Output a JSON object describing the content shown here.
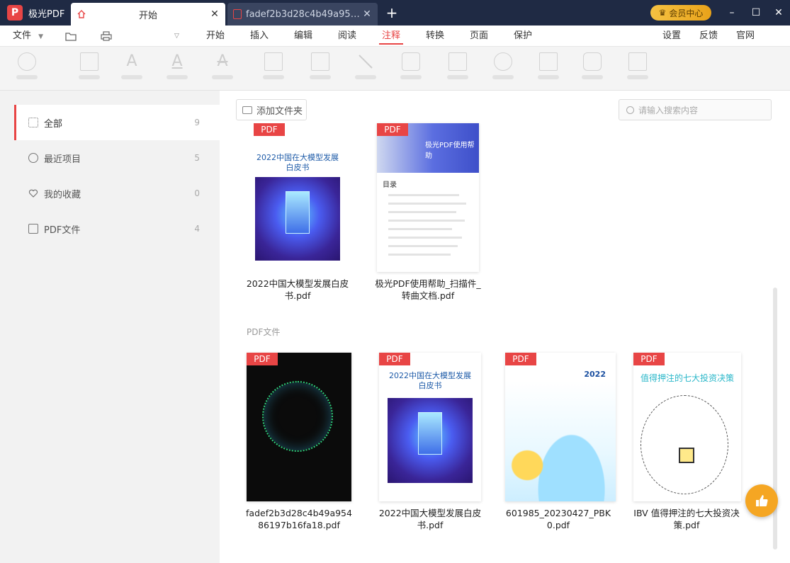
{
  "app": {
    "name": "极光PDF"
  },
  "tabs": [
    {
      "label": "开始",
      "close": "✕"
    },
    {
      "label": "fadef2b3d28c4b49a9548...",
      "close": "✕"
    }
  ],
  "new_tab": "+",
  "vip": {
    "label": "会员中心"
  },
  "window": {
    "minimize": "–",
    "maximize": "☐",
    "close": "✕"
  },
  "menu": {
    "file": "文件",
    "items": [
      "开始",
      "插入",
      "编辑",
      "阅读",
      "注释",
      "转换",
      "页面",
      "保护"
    ],
    "active": "注释",
    "right": [
      "设置",
      "反馈",
      "官网"
    ]
  },
  "sidebar": {
    "items": [
      {
        "label": "全部",
        "count": "9",
        "icon": "grid-icon"
      },
      {
        "label": "最近项目",
        "count": "5",
        "icon": "clock-icon"
      },
      {
        "label": "我的收藏",
        "count": "0",
        "icon": "heart-icon"
      },
      {
        "label": "PDF文件",
        "count": "4",
        "icon": "folder-pdf-icon"
      }
    ]
  },
  "main": {
    "add_folder": "添加文件夹",
    "search_placeholder": "请输入搜索内容",
    "section_pdf": "PDF文件",
    "badge": "PDF",
    "files_top": [
      {
        "name": "2022中国大模型发展白皮书.pdf",
        "thumb_title": "2022中国在大模型发展白皮书"
      },
      {
        "name": "极光PDF使用帮助_扫描件_转曲文档.pdf",
        "thumb_title": "极光PDF使用帮助",
        "toc": "目录"
      }
    ],
    "files_bottom": [
      {
        "name": "fadef2b3d28c4b49a95486197b16fa18.pdf"
      },
      {
        "name": "2022中国大模型发展白皮书.pdf",
        "thumb_title": "2022中国在大模型发展白皮书"
      },
      {
        "name": "601985_20230427_PBK0.pdf",
        "thumb_title": "2022"
      },
      {
        "name": "IBV 值得押注的七大投资决策.pdf",
        "thumb_title": "值得押注的七大投资决策"
      }
    ]
  },
  "colors": {
    "accent": "#e84545",
    "titlebar": "#1f2a44",
    "vip": "#f5c242",
    "like": "#f5a623"
  }
}
